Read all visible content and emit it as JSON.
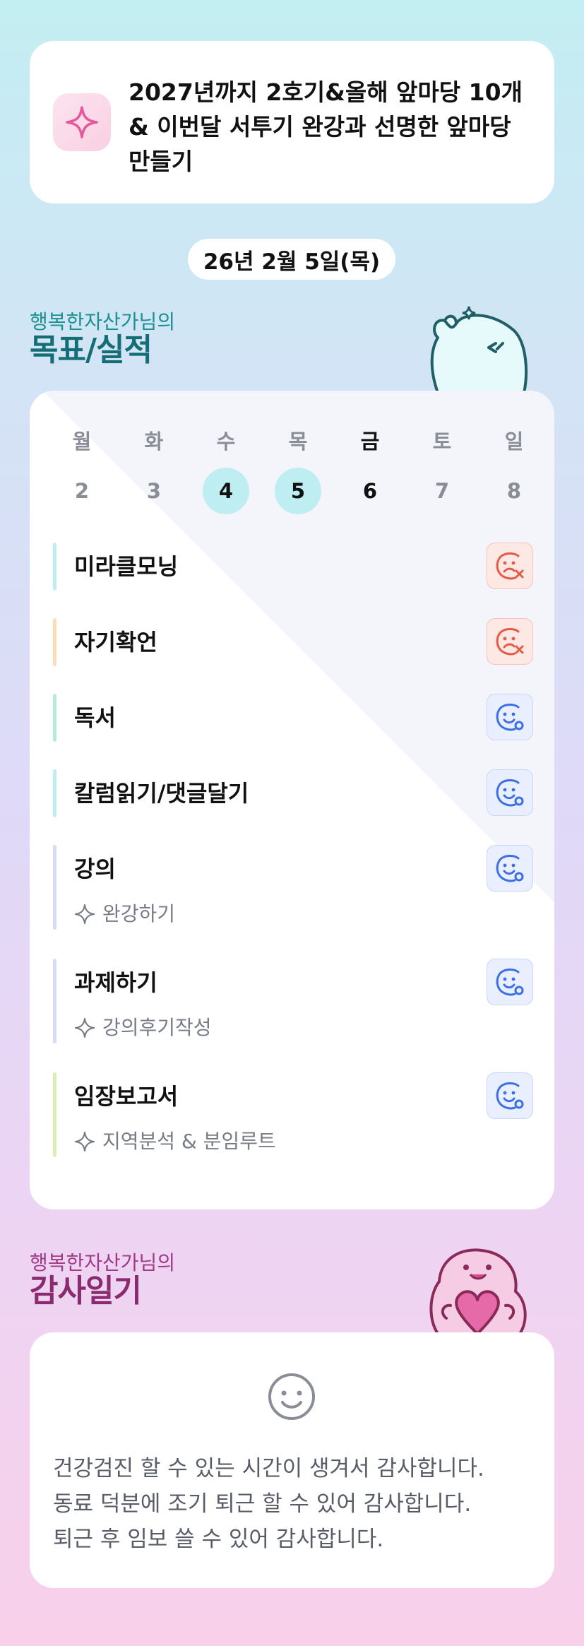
{
  "goal": {
    "icon": "sparkle-icon",
    "text": "2027년까지 2호기&올해 앞마당 10개 & 이번달 서투기 완강과 선명한 앞마당 만들기"
  },
  "date_label": "26년 2월 5일(목)",
  "goals_section": {
    "subtitle": "행복한자산가님의",
    "title": "목표/실적"
  },
  "week": [
    {
      "day": "월",
      "num": "2",
      "state": "normal"
    },
    {
      "day": "화",
      "num": "3",
      "state": "normal"
    },
    {
      "day": "수",
      "num": "4",
      "state": "done"
    },
    {
      "day": "목",
      "num": "5",
      "state": "done"
    },
    {
      "day": "금",
      "num": "6",
      "state": "today"
    },
    {
      "day": "토",
      "num": "7",
      "state": "normal"
    },
    {
      "day": "일",
      "num": "8",
      "state": "normal"
    }
  ],
  "goals": [
    {
      "label": "미라클모닝",
      "sub": "",
      "status": "fail",
      "bar_color": "#bfeef2"
    },
    {
      "label": "자기확언",
      "sub": "",
      "status": "fail",
      "bar_color": "#fddcb8"
    },
    {
      "label": "독서",
      "sub": "",
      "status": "done",
      "bar_color": "#b4ecd9"
    },
    {
      "label": "칼럼읽기/댓글달기",
      "sub": "",
      "status": "done",
      "bar_color": "#bfeef2"
    },
    {
      "label": "강의",
      "sub": "완강하기",
      "status": "done",
      "bar_color": "#d6dcf6"
    },
    {
      "label": "과제하기",
      "sub": "강의후기작성",
      "status": "done",
      "bar_color": "#d6dcf6"
    },
    {
      "label": "임장보고서",
      "sub": "지역분석 & 분임루트",
      "status": "done",
      "bar_color": "#d9f0b5"
    }
  ],
  "gratitude_section": {
    "subtitle": "행복한자산가님의",
    "title": "감사일기"
  },
  "gratitude": {
    "icon": "smile-icon",
    "lines": [
      "건강검진 할 수 있는 시간이 생겨서 감사합니다.",
      "동료 덕분에 조기 퇴근 할 수 있어 감사합니다.",
      "퇴근 후 임보 쓸 수 있어 감사합니다."
    ]
  },
  "colors": {
    "teal_title": "#156e76",
    "plum_title": "#8a2a6f",
    "fail_icon": "#e65a45",
    "done_icon": "#3b6fe6",
    "done_day": "#bfeef2"
  }
}
